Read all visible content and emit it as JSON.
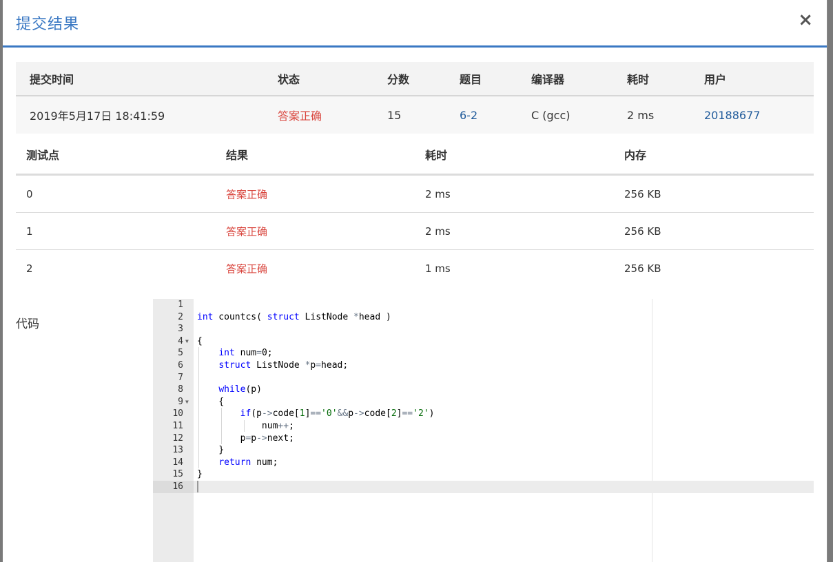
{
  "modal": {
    "title": "提交结果",
    "close_label": "×"
  },
  "summary": {
    "headers": [
      "提交时间",
      "状态",
      "分数",
      "题目",
      "编译器",
      "耗时",
      "用户"
    ],
    "row": {
      "time": "2019年5月17日 18:41:59",
      "status": "答案正确",
      "score": "15",
      "problem": "6-2",
      "compiler": "C (gcc)",
      "duration": "2 ms",
      "user": "20188677"
    }
  },
  "tests": {
    "headers": [
      "测试点",
      "结果",
      "耗时",
      "内存"
    ],
    "rows": [
      {
        "id": "0",
        "result": "答案正确",
        "time": "2 ms",
        "memory": "256 KB"
      },
      {
        "id": "1",
        "result": "答案正确",
        "time": "2 ms",
        "memory": "256 KB"
      },
      {
        "id": "2",
        "result": "答案正确",
        "time": "1 ms",
        "memory": "256 KB"
      }
    ]
  },
  "code": {
    "label": "代码",
    "line_numbers": [
      "1",
      "2",
      "3",
      "4",
      "5",
      "6",
      "7",
      "8",
      "9",
      "10",
      "11",
      "12",
      "13",
      "14",
      "15",
      "16"
    ]
  },
  "colors": {
    "accent": "#3a78c3",
    "success": "#d9453d",
    "link": "#1f5a9a"
  },
  "icons": {
    "close": "close-icon",
    "fold": "fold-arrow-icon"
  }
}
